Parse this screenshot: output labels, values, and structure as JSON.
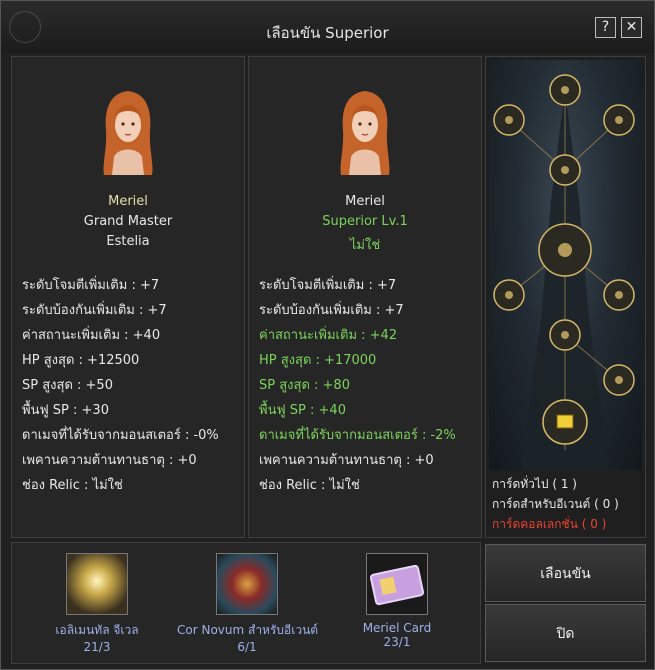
{
  "title": "เลือนขัน Superior",
  "help_label": "?",
  "close_label": "✕",
  "left": {
    "name": "Meriel",
    "class": "Grand Master",
    "server": "Estelia",
    "stats": [
      "ระดับโจมตีเพิ่มเติม : +7",
      "ระดับบ้องกันเพิ่มเติม : +7",
      "ค่าสถานะเพิ่มเติม : +40",
      "HP สูงสุด : +12500",
      "SP สูงสุด : +50",
      "พื้นฟู SP : +30",
      "ดาเมจที่ได้รับจากมอนสเตอร์ : -0%",
      "เพคานความต้านทานธาตุ : +0",
      "ช่อง Relic : ไม่ใช่"
    ]
  },
  "right": {
    "name": "Meriel",
    "class": "Superior Lv.1",
    "server": "ไม่ใช่",
    "stats": [
      "ระดับโจมตีเพิ่มเติม : +7",
      "ระดับบ้องกันเพิ่มเติม : +7",
      "ค่าสถานะเพิ่มเติม : +42",
      "HP สูงสุด : +17000",
      "SP สูงสุด : +80",
      "พื้นฟู SP : +40",
      "ดาเมจที่ได้รับจากมอนสเตอร์ : -2%",
      "เพคานความต้านทานธาตุ : +0",
      "ช่อง Relic : ไม่ใช่"
    ]
  },
  "cards": {
    "general": "การ์ดทั่วไป ( 1 )",
    "event": "การ์ดสำหรับอีเวนต์ ( 0 )",
    "collection": "การ์ดคอลเลกชั่น ( 0 )"
  },
  "materials": [
    {
      "label": "เอลิเมนทัล จีเวล",
      "count": "21/3"
    },
    {
      "label": "Cor Novum สำหรับอีเวนต์",
      "count": "6/1"
    },
    {
      "label": "Meriel Card",
      "count": "23/1"
    }
  ],
  "buttons": {
    "promote": "เลือนขัน",
    "close": "ปิด"
  },
  "colors": {
    "improved_stat": "#7cd35b",
    "collection_text": "#e8442f",
    "material_text": "#9fb0e8",
    "name_text": "#e8dfa8"
  }
}
